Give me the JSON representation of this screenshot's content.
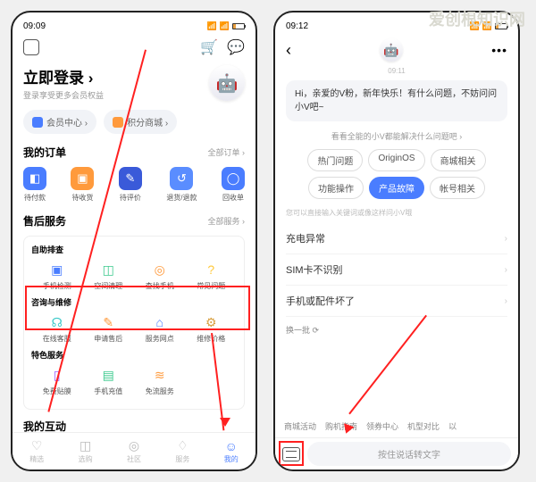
{
  "watermark": "爱创根知识网",
  "left": {
    "status": {
      "time": "09:09",
      "icons": "◉ ⚙ ◔ ◕"
    },
    "login": {
      "title": "立即登录 ›",
      "sub": "登录享受更多会员权益"
    },
    "pills": {
      "member": "会员中心 ›",
      "points": "积分商城 ›"
    },
    "orders": {
      "title": "我的订单",
      "more": "全部订单 ›",
      "items": [
        {
          "label": "待付款",
          "glyph": "◧"
        },
        {
          "label": "待收货",
          "glyph": "▣"
        },
        {
          "label": "待评价",
          "glyph": "✎"
        },
        {
          "label": "退货/退款",
          "glyph": "↺"
        },
        {
          "label": "回收单",
          "glyph": "◯"
        }
      ]
    },
    "after": {
      "title": "售后服务",
      "more": "全部服务 ›",
      "group1": {
        "label": "自助排查",
        "items": [
          {
            "label": "手机检测",
            "glyph": "▣",
            "cls": "c-blue"
          },
          {
            "label": "空间清理",
            "glyph": "◫",
            "cls": "c-green"
          },
          {
            "label": "查找手机",
            "glyph": "◎",
            "cls": "c-orange"
          },
          {
            "label": "常见问题",
            "glyph": "?",
            "cls": "c-yellow"
          }
        ]
      },
      "group2": {
        "label": "咨询与维修",
        "items": [
          {
            "label": "在线客服",
            "glyph": "☊",
            "cls": "c-cyan"
          },
          {
            "label": "申请售后",
            "glyph": "✎",
            "cls": "c-orange"
          },
          {
            "label": "服务网点",
            "glyph": "⌂",
            "cls": "c-blue"
          },
          {
            "label": "维修价格",
            "glyph": "⚙",
            "cls": "c-gold"
          }
        ]
      },
      "group3": {
        "label": "特色服务",
        "items": [
          {
            "label": "免费贴膜",
            "glyph": "▯",
            "cls": "c-purple"
          },
          {
            "label": "手机充值",
            "glyph": "▤",
            "cls": "c-green"
          },
          {
            "label": "免流服务",
            "glyph": "≋",
            "cls": "c-orange"
          },
          {
            "label": "",
            "glyph": "",
            "cls": ""
          }
        ]
      }
    },
    "interact": {
      "title": "我的互动"
    },
    "nav": [
      {
        "label": "精选",
        "glyph": "♡"
      },
      {
        "label": "选购",
        "glyph": "◫"
      },
      {
        "label": "社区",
        "glyph": "◎"
      },
      {
        "label": "服务",
        "glyph": "♢"
      },
      {
        "label": "我的",
        "glyph": "☺"
      }
    ]
  },
  "right": {
    "status": {
      "time": "09:12",
      "icons": "◎ ◔ ⚙ ◍ ◕"
    },
    "ts": "09:11",
    "bubble": "Hi，亲爱的V粉，新年快乐！有什么问题，不妨问问小V吧~",
    "hint": "看看全能的小V都能解决什么问题吧 ›",
    "chips": [
      "热门问题",
      "OriginOS",
      "商城相关",
      "功能操作",
      "产品故障",
      "帐号相关"
    ],
    "chip_active": 4,
    "hint2": "您可以直接输入关键词或像这样问小V哦",
    "qs": [
      "充电异常",
      "SIM卡不识别",
      "手机或配件坏了"
    ],
    "refresh": "换一批 ⟳",
    "suggestions": [
      "商城活动",
      "购机指南",
      "领券中心",
      "机型对比",
      "以"
    ],
    "voice": "按住说话转文字"
  }
}
